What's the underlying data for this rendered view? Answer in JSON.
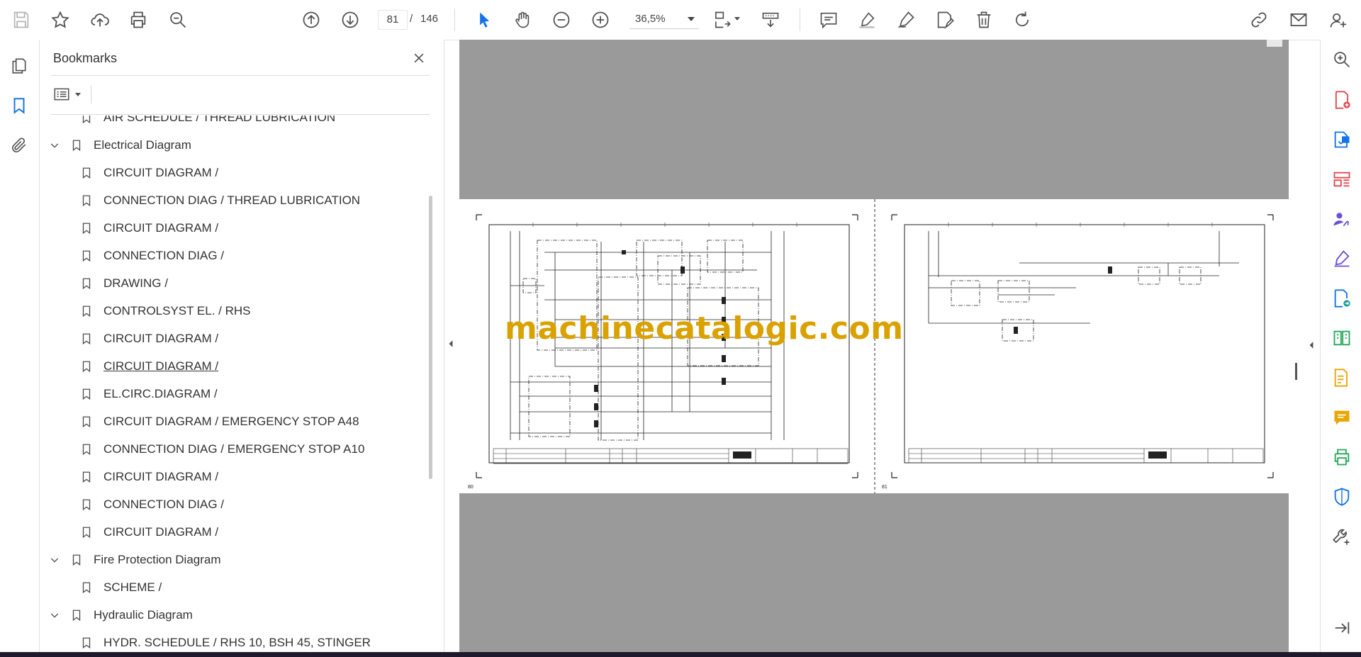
{
  "toolbar": {
    "page_current": "81",
    "page_separator": "/",
    "page_total": "146",
    "zoom": "36,5%"
  },
  "bookmarks": {
    "title": "Bookmarks",
    "items": [
      {
        "label": "AIR SCHEDULE / THREAD LUBRICATION",
        "level": 2
      },
      {
        "label": "Electrical Diagram",
        "level": 1,
        "expanded": true
      },
      {
        "label": "CIRCUIT DIAGRAM /",
        "level": 2
      },
      {
        "label": "CONNECTION DIAG / THREAD LUBRICATION",
        "level": 2
      },
      {
        "label": "CIRCUIT DIAGRAM /",
        "level": 2
      },
      {
        "label": "CONNECTION DIAG /",
        "level": 2
      },
      {
        "label": "DRAWING /",
        "level": 2
      },
      {
        "label": "CONTROLSYST EL. / RHS",
        "level": 2
      },
      {
        "label": "CIRCUIT DIAGRAM /",
        "level": 2
      },
      {
        "label": "CIRCUIT DIAGRAM /",
        "level": 2,
        "selected": true
      },
      {
        "label": "EL.CIRC.DIAGRAM /",
        "level": 2
      },
      {
        "label": "CIRCUIT DIAGRAM / EMERGENCY STOP A48",
        "level": 2
      },
      {
        "label": "CONNECTION DIAG / EMERGENCY STOP A10",
        "level": 2
      },
      {
        "label": "CIRCUIT DIAGRAM /",
        "level": 2
      },
      {
        "label": "CONNECTION DIAG /",
        "level": 2
      },
      {
        "label": "CIRCUIT DIAGRAM /",
        "level": 2
      },
      {
        "label": "Fire Protection Diagram",
        "level": 1,
        "expanded": true
      },
      {
        "label": "SCHEME /",
        "level": 2
      },
      {
        "label": "Hydraulic Diagram",
        "level": 1,
        "expanded": true
      },
      {
        "label": "HYDR. SCHEDULE / RHS 10, BSH 45, STINGER",
        "level": 2
      }
    ]
  },
  "document": {
    "watermark": "machinecatalogic.com",
    "left_page_number": "80",
    "right_page_number": "81"
  },
  "colors": {
    "accent_blue": "#1473e6",
    "icon_gray": "#505050",
    "doc_background": "#9a9a9a",
    "watermark": "#d9a200",
    "tool_red": "#e34850",
    "tool_purple": "#6d4fd6",
    "tool_green": "#26a85a",
    "tool_yellow": "#e8a600"
  }
}
